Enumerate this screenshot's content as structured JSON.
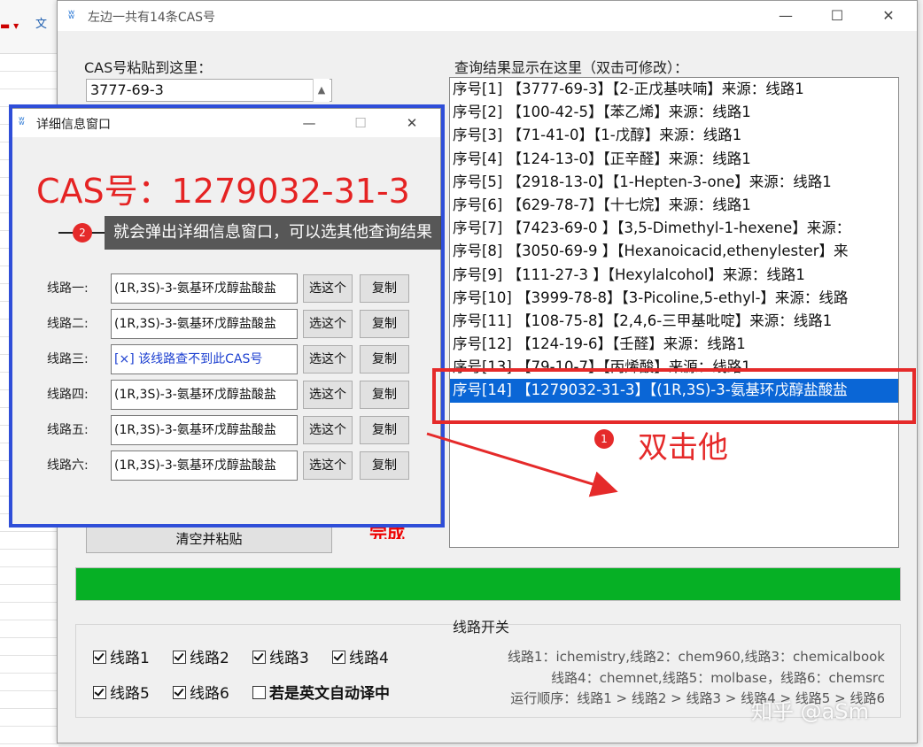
{
  "excel": {
    "ribbon_text": "文"
  },
  "main": {
    "title": "左边一共有14条CAS号",
    "cas_label": "CAS号粘贴到这里：",
    "cas_value": "3777-69-3",
    "result_label": "查询结果显示在这里（双击可修改）：",
    "results": [
      "序号[1] 【3777-69-3】【2-正戊基呋喃】来源：线路1",
      "序号[2] 【100-42-5】【苯乙烯】来源：线路1",
      "序号[3] 【71-41-0】【1-戊醇】来源：线路1",
      "序号[4] 【124-13-0】【正辛醛】来源：线路1",
      "序号[5] 【2918-13-0】【1-Hepten-3-one】来源：线路1",
      "序号[6] 【629-78-7】【十七烷】来源：线路1",
      "序号[7] 【7423-69-0 】【3,5-Dimethyl-1-hexene】来源：",
      "序号[8] 【3050-69-9 】【Hexanoicacid,ethenylester】来",
      "序号[9] 【111-27-3 】【Hexylalcohol】来源：线路1",
      "序号[10] 【3999-78-8】【3-Picoline,5-ethyl-】来源：线路",
      "序号[11] 【108-75-8】【2,4,6-三甲基吡啶】来源：线路1",
      "序号[12] 【124-19-6】【壬醛】来源：线路1",
      "序号[13] 【79-10-7】【丙烯酸】来源：线路1",
      "序号[14] 【1279032-31-3】【(1R,3S)-3-氨基环戊醇盐酸盐"
    ],
    "selected_index": 13,
    "clear_button": "清空并粘贴",
    "done_text": "完成",
    "progress": 1.0,
    "route_switch_title": "线路开关",
    "checkboxes": [
      {
        "label": "线路1",
        "checked": true
      },
      {
        "label": "线路2",
        "checked": true
      },
      {
        "label": "线路3",
        "checked": true
      },
      {
        "label": "线路4",
        "checked": true
      },
      {
        "label": "线路5",
        "checked": true
      },
      {
        "label": "线路6",
        "checked": true
      },
      {
        "label": "若是英文自动译中",
        "checked": false
      }
    ],
    "info_line1": "线路1：ichemistry,线路2：chem960,线路3：chemicalbook",
    "info_line2": "线路4：chemnet,线路5：molbase，线路6：chemsrc",
    "info_line3": "运行顺序：线路1 > 线路2 > 线路3 > 线路4 > 线路5 > 线路6"
  },
  "detail": {
    "title": "详细信息窗口",
    "cas_heading": "CAS号：1279032-31-3",
    "routes": [
      {
        "label": "线路一:",
        "value": "(1R,3S)-3-氨基环戊醇盐酸盐"
      },
      {
        "label": "线路二:",
        "value": "(1R,3S)-3-氨基环戊醇盐酸盐"
      },
      {
        "label": "线路三:",
        "value": "[×] 该线路查不到此CAS号"
      },
      {
        "label": "线路四:",
        "value": "(1R,3S)-3-氨基环戊醇盐酸盐"
      },
      {
        "label": "线路五:",
        "value": "(1R,3S)-3-氨基环戊醇盐酸盐"
      },
      {
        "label": "线路六:",
        "value": "(1R,3S)-3-氨基环戊醇盐酸盐"
      }
    ],
    "select_label": "选这个",
    "copy_label": "复制"
  },
  "annotations": {
    "callout_num": "2",
    "callout_text": "就会弹出详细信息窗口，可以选其他查询结果",
    "note1_num": "1",
    "note1_text": "双击他"
  },
  "watermark": "知乎 @aSm",
  "colors": {
    "accent_red": "#e52a2a",
    "frame_blue": "#2f4ed8",
    "progress_green": "#06b025",
    "selection_blue": "#0a66d6"
  }
}
